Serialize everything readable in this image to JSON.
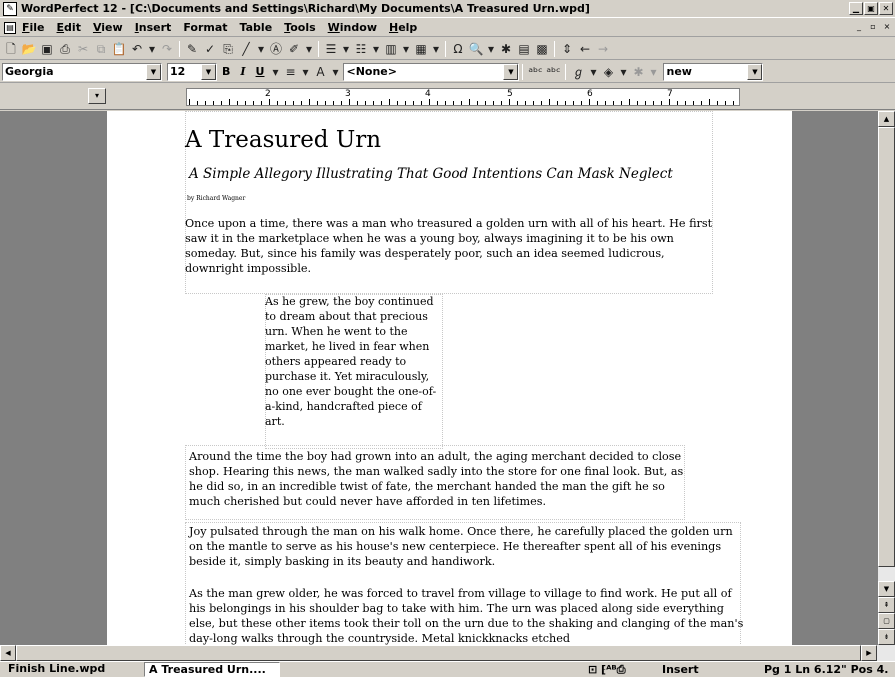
{
  "window": {
    "title": "WordPerfect 12 - [C:\\Documents and Settings\\Richard\\My Documents\\A Treasured Urn.wpd]",
    "minimize_icon": "minimize-icon",
    "maximize_icon": "maximize-icon"
  },
  "menu": {
    "items": [
      {
        "first": "F",
        "rest": "ile"
      },
      {
        "first": "E",
        "rest": "dit"
      },
      {
        "first": "V",
        "rest": "iew"
      },
      {
        "first": "I",
        "rest": "nsert"
      },
      {
        "first": "Fo",
        "rest": "rmat"
      },
      {
        "first": "Ta",
        "rest": "ble"
      },
      {
        "first": "T",
        "rest": "ools"
      },
      {
        "first": "W",
        "rest": "indow"
      },
      {
        "first": "H",
        "rest": "elp"
      }
    ]
  },
  "toolbar": {
    "icons": [
      "new-icon",
      "open-icon",
      "save-icon",
      "print-icon",
      "cut-icon",
      "copy-icon",
      "paste-icon",
      "undo-icon",
      "redo-icon",
      "highlight-icon",
      "clipboard-icon",
      "line-icon",
      "text-box-icon",
      "draw-icon",
      "bullets-icon",
      "numbering-icon",
      "columns-icon",
      "table-icon",
      "symbol-icon",
      "zoom-icon",
      "asian-icon",
      "chart-icon",
      "arrow-up-down-icon",
      "back-icon",
      "forward-icon"
    ]
  },
  "property_bar": {
    "font_name": "Georgia",
    "font_size": "12",
    "bold": "B",
    "italic": "I",
    "underline": "U",
    "style": "<None>",
    "language": "new"
  },
  "ruler": {
    "numbers": [
      "2",
      "3",
      "4",
      "5",
      "6",
      "7"
    ]
  },
  "document": {
    "title": "A Treasured Urn",
    "subtitle": "A Simple Allegory Illustrating That Good Intentions Can Mask Neglect",
    "byline": "by Richard Wagner",
    "paragraphs": [
      "Once upon a time, there was a man who treasured a golden urn with all of his heart. He first saw it in the marketplace when he was a young boy, always imagining it to be his own someday. But, since his family was desperately poor, such an idea seemed ludicrous, downright impossible.",
      "As he grew, the boy continued to dream about that precious urn. When he went to the market, he lived in fear when others appeared ready to purchase it. Yet miraculously, no one ever bought the one-of-a-kind, handcrafted piece of art.",
      "Around the time the boy had grown into an adult, the aging merchant decided to close shop. Hearing this news, the man walked sadly into the store for one final look. But, as he did so, in an incredible twist of fate, the merchant handed the man the gift he so much cherished but could never have afforded in ten lifetimes.",
      "Joy pulsated through the man on his walk home. Once there, he carefully placed the golden urn on the mantle to serve as his house's new centerpiece. He thereafter spent all of his evenings beside it, simply basking in its beauty and handiwork.",
      "As the man grew older, he was forced to travel from village to village to find work. He put all of his belongings in his shoulder bag to take with him. The urn was placed along side everything else, but these other items took their toll on the urn due to the shaking and clanging of the man's day-long walks through the countryside. Metal knickknacks etched"
    ]
  },
  "status": {
    "tab1": "Finish Line.wpd",
    "tab2": "A Treasured Urn....",
    "mode": "Insert",
    "position": "Pg 1 Ln 6.12\" Pos 4."
  }
}
